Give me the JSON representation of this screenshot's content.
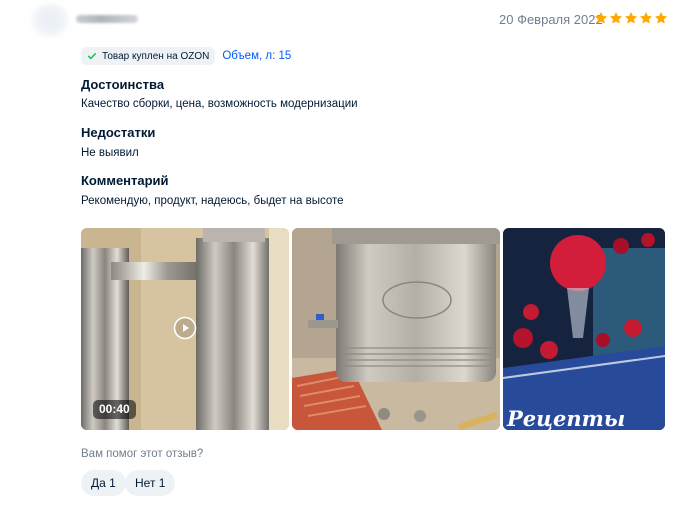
{
  "review": {
    "date": "20 Февраля 2022",
    "rating": 5,
    "star_color": "#ffa800"
  },
  "meta": {
    "badge_text": "Товар куплен на OZON",
    "volume_text": "Объем, л: 15"
  },
  "sections": {
    "pros_title": "Достоинства",
    "pros_text": "Качество сборки, цена, возможность модернизации",
    "cons_title": "Недостатки",
    "cons_text": "Не выявил",
    "comment_title": "Комментарий",
    "comment_text": "Рекомендую, продукт, надеюсь, быдет на высоте"
  },
  "media": {
    "video_duration": "00:40",
    "photo3_sign": "Рецепты"
  },
  "helpful": {
    "question": "Вам помог этот отзыв?",
    "yes_label": "Да 1",
    "no_label": "Нет 1"
  },
  "colors": {
    "link": "#005bff",
    "muted": "#707f8d",
    "chip_bg": "#eff2f5",
    "check": "#10c44c"
  }
}
